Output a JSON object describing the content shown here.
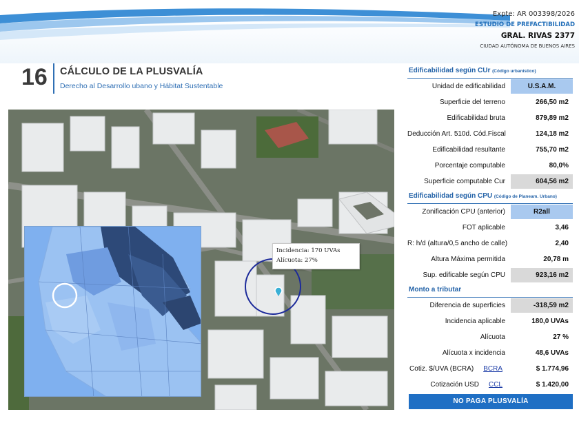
{
  "header": {
    "expte": "Expte: AR 003398/2026",
    "estudio": "ESTUDIO DE PREFACTIBILIDAD",
    "address": "GRAL. RIVAS 2377",
    "city": "CIUDAD AUTÓNOMA DE BUENOS AIRES"
  },
  "section": {
    "number": "16",
    "title": "CÁLCULO DE LA PLUSVALÍA",
    "subtitle": "Derecho al Desarrollo ubano y Hábitat Sustentable"
  },
  "map": {
    "tooltip_line1": "Incidencia: 170 UVAs",
    "tooltip_line2": "Alícuota: 27%"
  },
  "cur": {
    "title": "Edificabilidad según CUr",
    "title_small": "(Código urbanístico)",
    "rows": [
      {
        "label": "Unidad de edificabilidad",
        "value": "U.S.A.M."
      },
      {
        "label": "Superficie del terreno",
        "value": "266,50 m2"
      },
      {
        "label": "Edificabilidad bruta",
        "value": "879,89 m2"
      },
      {
        "label": "Deducción Art. 510d. Cód.Fiscal",
        "value": "124,18 m2"
      },
      {
        "label": "Edificabilidad resultante",
        "value": "755,70 m2"
      },
      {
        "label": "Porcentaje computable",
        "value": "80,0%"
      },
      {
        "label": "Superficie computable Cur",
        "value": "604,56 m2"
      }
    ]
  },
  "cpu": {
    "title": "Edificabilidad según CPU",
    "title_small": "(Código de Planeam. Urbano)",
    "rows": [
      {
        "label": "Zonificación CPU (anterior)",
        "value": "R2all"
      },
      {
        "label": "FOT aplicable",
        "value": "3,46"
      },
      {
        "label": "R: h/d (altura/0,5 ancho de calle)",
        "value": "2,40"
      },
      {
        "label": "Altura Máxima permitida",
        "value": "20,78 m"
      },
      {
        "label": "Sup. edificable según CPU",
        "value": "923,16 m2"
      }
    ]
  },
  "monto": {
    "title": "Monto a tributar",
    "rows": [
      {
        "label": "Diferencia de superficies",
        "value": "-318,59 m2"
      },
      {
        "label": "Incidencia aplicable",
        "value": "180,0 UVAs"
      },
      {
        "label": "Alícuota",
        "value": "27 %"
      },
      {
        "label": "Alícuota x incidencia",
        "value": "48,6 UVAs"
      },
      {
        "label": "Cotiz. $/UVA (BCRA)",
        "link": "BCRA",
        "value": "$ 1.774,96"
      },
      {
        "label": "Cotización USD",
        "link": "CCL",
        "value": "$ 1.420,00"
      }
    ],
    "result": "NO PAGA PLUSVALÍA"
  }
}
